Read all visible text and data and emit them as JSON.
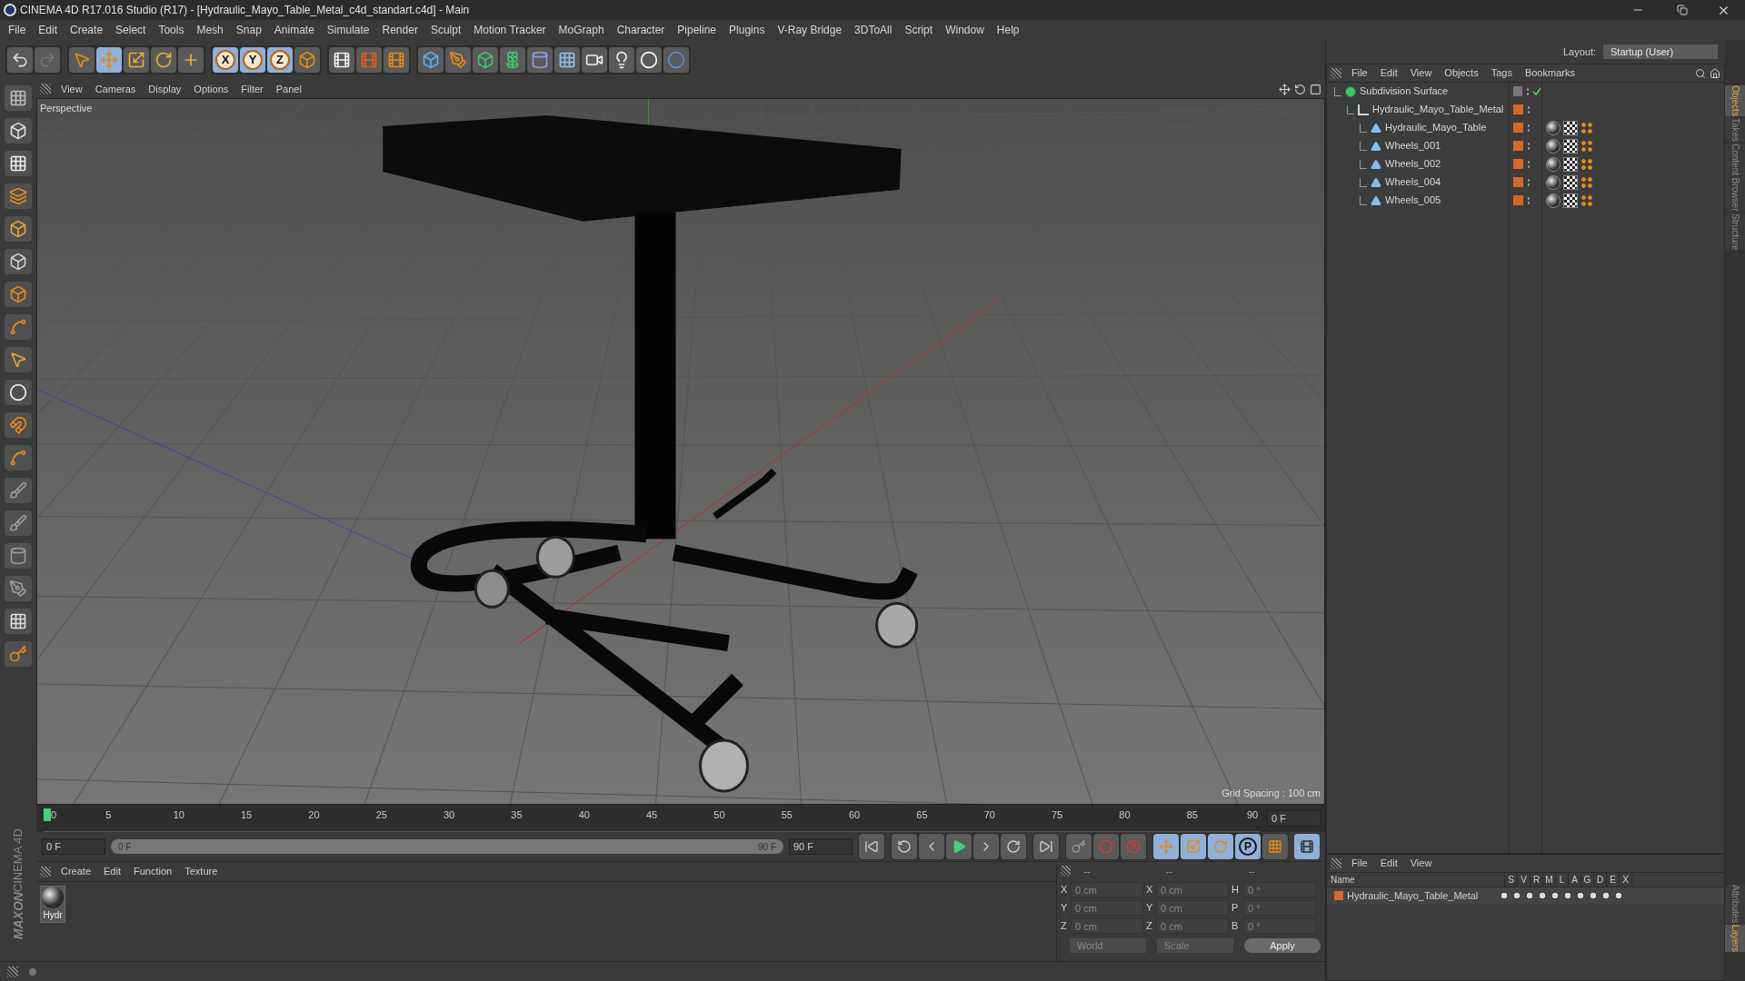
{
  "window": {
    "title": "CINEMA 4D R17.016 Studio (R17) - [Hydraulic_Mayo_Table_Metal_c4d_standart.c4d] - Main"
  },
  "menu": [
    "File",
    "Edit",
    "Create",
    "Select",
    "Tools",
    "Mesh",
    "Snap",
    "Animate",
    "Simulate",
    "Render",
    "Sculpt",
    "Motion Tracker",
    "MoGraph",
    "Character",
    "Pipeline",
    "Plugins",
    "V-Ray Bridge",
    "3DToAll",
    "Script",
    "Window",
    "Help"
  ],
  "layout": {
    "label": "Layout:",
    "value": "Startup (User)"
  },
  "axis_buttons": [
    {
      "label": "X",
      "selected": true
    },
    {
      "label": "Y",
      "selected": true
    },
    {
      "label": "Z",
      "selected": true
    }
  ],
  "viewport": {
    "menu": [
      "View",
      "Cameras",
      "Display",
      "Options",
      "Filter",
      "Panel"
    ],
    "camera": "Perspective",
    "grid_spacing": "Grid Spacing : 100 cm"
  },
  "timeline": {
    "ticks": [
      "0",
      "5",
      "10",
      "15",
      "20",
      "25",
      "30",
      "35",
      "40",
      "45",
      "50",
      "55",
      "60",
      "65",
      "70",
      "75",
      "80",
      "85",
      "90"
    ],
    "current_frame": "0 F",
    "start": "0 F",
    "range_start": "0 F",
    "range_end": "90 F",
    "range": {
      "level": 1
    },
    "end": "90 F"
  },
  "playback": {
    "parameter_key": "P"
  },
  "materials": {
    "menu": [
      "Create",
      "Edit",
      "Function",
      "Texture"
    ],
    "items": [
      {
        "name": "Hydr"
      }
    ]
  },
  "coordinates": {
    "headers": [
      "--",
      "--",
      "--"
    ],
    "rows": [
      {
        "axis": "X",
        "position": "0 cm",
        "size_axis": "X",
        "size": "0 cm",
        "rotation_axis": "H",
        "rotation": "0 °"
      },
      {
        "axis": "Y",
        "position": "0 cm",
        "size_axis": "Y",
        "size": "0 cm",
        "rotation_axis": "P",
        "rotation": "0 °"
      },
      {
        "axis": "Z",
        "position": "0 cm",
        "size_axis": "Z",
        "size": "0 cm",
        "rotation_axis": "B",
        "rotation": "0 °"
      }
    ],
    "mode": "World",
    "size_mode": "Scale",
    "apply": "Apply"
  },
  "objects": {
    "menu": [
      "File",
      "Edit",
      "View",
      "Objects",
      "Tags",
      "Bookmarks"
    ],
    "tree": [
      {
        "name": "Subdivision Surface",
        "kind": "subdivision",
        "enabled": true,
        "children": [
          {
            "name": "Hydraulic_Mayo_Table_Metal",
            "kind": "null",
            "children": [
              {
                "name": "Hydraulic_Mayo_Table",
                "kind": "polygon"
              },
              {
                "name": "Wheels_001",
                "kind": "polygon"
              },
              {
                "name": "Wheels_002",
                "kind": "polygon"
              },
              {
                "name": "Wheels_004",
                "kind": "polygon"
              },
              {
                "name": "Wheels_005",
                "kind": "polygon"
              }
            ]
          }
        ]
      }
    ]
  },
  "layers": {
    "menu": [
      "File",
      "Edit",
      "View"
    ],
    "columns": [
      "Name",
      "S",
      "V",
      "R",
      "M",
      "L",
      "A",
      "G",
      "D",
      "E",
      "X"
    ],
    "rows": [
      {
        "name": "Hydraulic_Mayo_Table_Metal",
        "color": "#d4682a"
      }
    ]
  },
  "side_tabs_top": [
    {
      "label": "Objects",
      "selected": true
    },
    {
      "label": "Takes",
      "selected": false
    },
    {
      "label": "Content Browser",
      "selected": false
    },
    {
      "label": "Structure",
      "selected": false
    }
  ],
  "side_tabs_bottom": [
    {
      "label": "Attributes",
      "selected": false
    },
    {
      "label": "Layers",
      "selected": true
    }
  ],
  "brand": {
    "company": "MAXON",
    "product": "CINEMA 4D"
  }
}
